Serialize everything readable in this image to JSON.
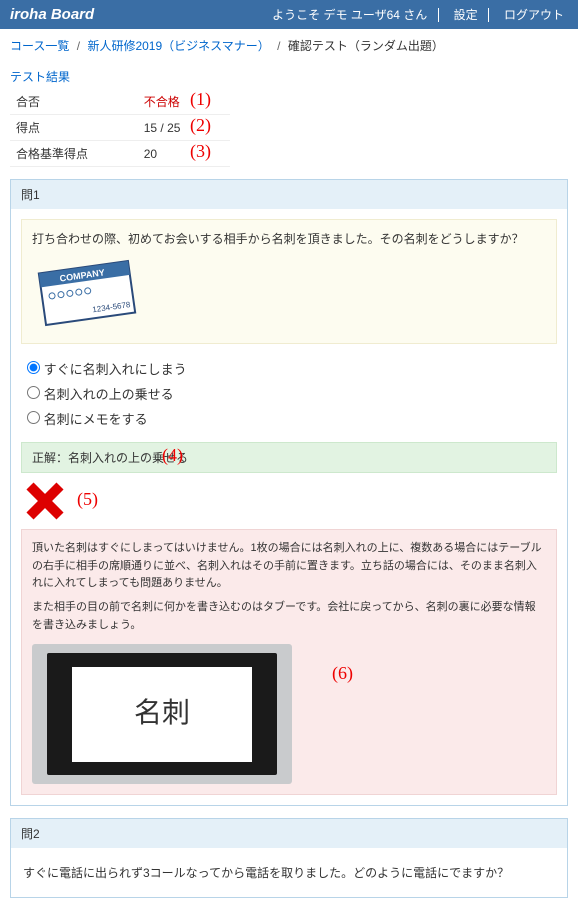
{
  "header": {
    "brand": "iroha Board",
    "welcome": "ようこそ デモ ユーザ64 さん",
    "settings": "設定",
    "logout": "ログアウト"
  },
  "breadcrumb": {
    "a": "コース一覧",
    "b": "新人研修2019（ビジネスマナー）",
    "c": "確認テスト（ランダム出題）"
  },
  "result": {
    "title": "テスト結果",
    "r1_label": "合否",
    "r1_value": "不合格",
    "r2_label": "得点",
    "r2_value": "15 / 25",
    "r3_label": "合格基準得点",
    "r3_value": "20"
  },
  "annot": {
    "a1": "(1)",
    "a2": "(2)",
    "a3": "(3)",
    "a4": "(4)",
    "a5": "(5)",
    "a6": "(6)"
  },
  "q1": {
    "head": "問1",
    "text": "打ち合わせの際、初めてお会いする相手から名刺を頂きました。その名刺をどうしますか？",
    "opt1": "すぐに名刺入れにしまう",
    "opt2": "名刺入れの上の乗せる",
    "opt3": "名刺にメモをする",
    "correct_label": "正解：名刺入れの上の乗せる",
    "explain1": "頂いた名刺はすぐにしまってはいけません。1枚の場合には名刺入れの上に、複数ある場合にはテーブルの右手に相手の席順通りに並べ、名刺入れはその手前に置きます。立ち話の場合には、そのまま名刺入れに入れてしまっても問題ありません。",
    "explain2": "また相手の目の前で名刺に何かを書き込むのはタブーです。会社に戻ってから、名刺の裏に必要な情報を書き込みましょう。",
    "meishi": "名刺"
  },
  "card": {
    "company": "COMPANY",
    "num": "1234-5678"
  },
  "q2": {
    "head": "問2",
    "text": "すぐに電話に出られず3コールなってから電話を取りました。どのように電話にでますか？"
  }
}
